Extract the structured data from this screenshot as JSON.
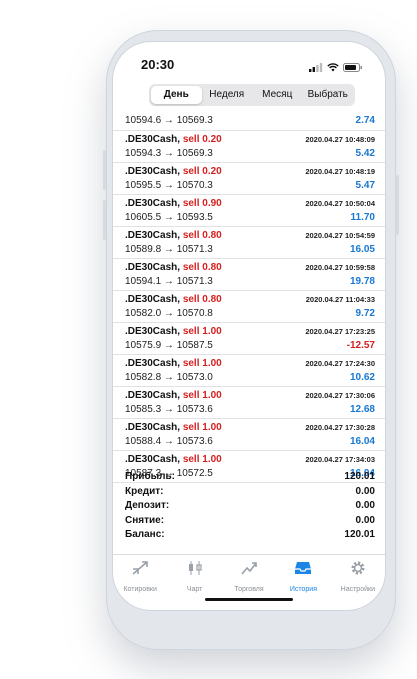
{
  "status": {
    "time": "20:30"
  },
  "periods": [
    {
      "label": "День",
      "active": true
    },
    {
      "label": "Неделя",
      "active": false
    },
    {
      "label": "Месяц",
      "active": false
    },
    {
      "label": "Выбрать",
      "active": false
    }
  ],
  "first_row": {
    "prices": "10594.6 → 10569.3",
    "profit": "2.74"
  },
  "deals": [
    {
      "symbol": ".DE30Cash,",
      "action": "sell 0.20",
      "date": "2020.04.27 10:48:09",
      "prices": "10594.3 → 10569.3",
      "profit": "5.42",
      "negative": false
    },
    {
      "symbol": ".DE30Cash,",
      "action": "sell 0.20",
      "date": "2020.04.27 10:48:19",
      "prices": "10595.5 → 10570.3",
      "profit": "5.47",
      "negative": false
    },
    {
      "symbol": ".DE30Cash,",
      "action": "sell 0.90",
      "date": "2020.04.27 10:50:04",
      "prices": "10605.5 → 10593.5",
      "profit": "11.70",
      "negative": false
    },
    {
      "symbol": ".DE30Cash,",
      "action": "sell 0.80",
      "date": "2020.04.27 10:54:59",
      "prices": "10589.8 → 10571.3",
      "profit": "16.05",
      "negative": false
    },
    {
      "symbol": ".DE30Cash,",
      "action": "sell 0.80",
      "date": "2020.04.27 10:59:58",
      "prices": "10594.1 → 10571.3",
      "profit": "19.78",
      "negative": false
    },
    {
      "symbol": ".DE30Cash,",
      "action": "sell 0.80",
      "date": "2020.04.27 11:04:33",
      "prices": "10582.0 → 10570.8",
      "profit": "9.72",
      "negative": false
    },
    {
      "symbol": ".DE30Cash,",
      "action": "sell 1.00",
      "date": "2020.04.27 17:23:25",
      "prices": "10575.9 → 10587.5",
      "profit": "-12.57",
      "negative": true
    },
    {
      "symbol": ".DE30Cash,",
      "action": "sell 1.00",
      "date": "2020.04.27 17:24:30",
      "prices": "10582.8 → 10573.0",
      "profit": "10.62",
      "negative": false
    },
    {
      "symbol": ".DE30Cash,",
      "action": "sell 1.00",
      "date": "2020.04.27 17:30:06",
      "prices": "10585.3 → 10573.6",
      "profit": "12.68",
      "negative": false
    },
    {
      "symbol": ".DE30Cash,",
      "action": "sell 1.00",
      "date": "2020.04.27 17:30:28",
      "prices": "10588.4 → 10573.6",
      "profit": "16.04",
      "negative": false
    },
    {
      "symbol": ".DE30Cash,",
      "action": "sell 1.00",
      "date": "2020.04.27 17:34:03",
      "prices": "10587.3 → 10572.5",
      "profit": "16.04",
      "negative": false
    }
  ],
  "summary": [
    {
      "label": "Прибыль:",
      "value": "120.01"
    },
    {
      "label": "Кредит:",
      "value": "0.00"
    },
    {
      "label": "Депозит:",
      "value": "0.00"
    },
    {
      "label": "Снятие:",
      "value": "0.00"
    },
    {
      "label": "Баланс:",
      "value": "120.01"
    }
  ],
  "tabs": [
    {
      "label": "Котировки",
      "icon": "quotes-icon",
      "active": false
    },
    {
      "label": "Чарт",
      "icon": "chart-icon",
      "active": false
    },
    {
      "label": "Торговля",
      "icon": "trade-icon",
      "active": false
    },
    {
      "label": "История",
      "icon": "history-icon",
      "active": true
    },
    {
      "label": "Настройки",
      "icon": "settings-icon",
      "active": false
    }
  ],
  "colors": {
    "accent": "#1c86e6",
    "profit": "#1877d2",
    "loss": "#d42020",
    "sell": "#d42020"
  }
}
